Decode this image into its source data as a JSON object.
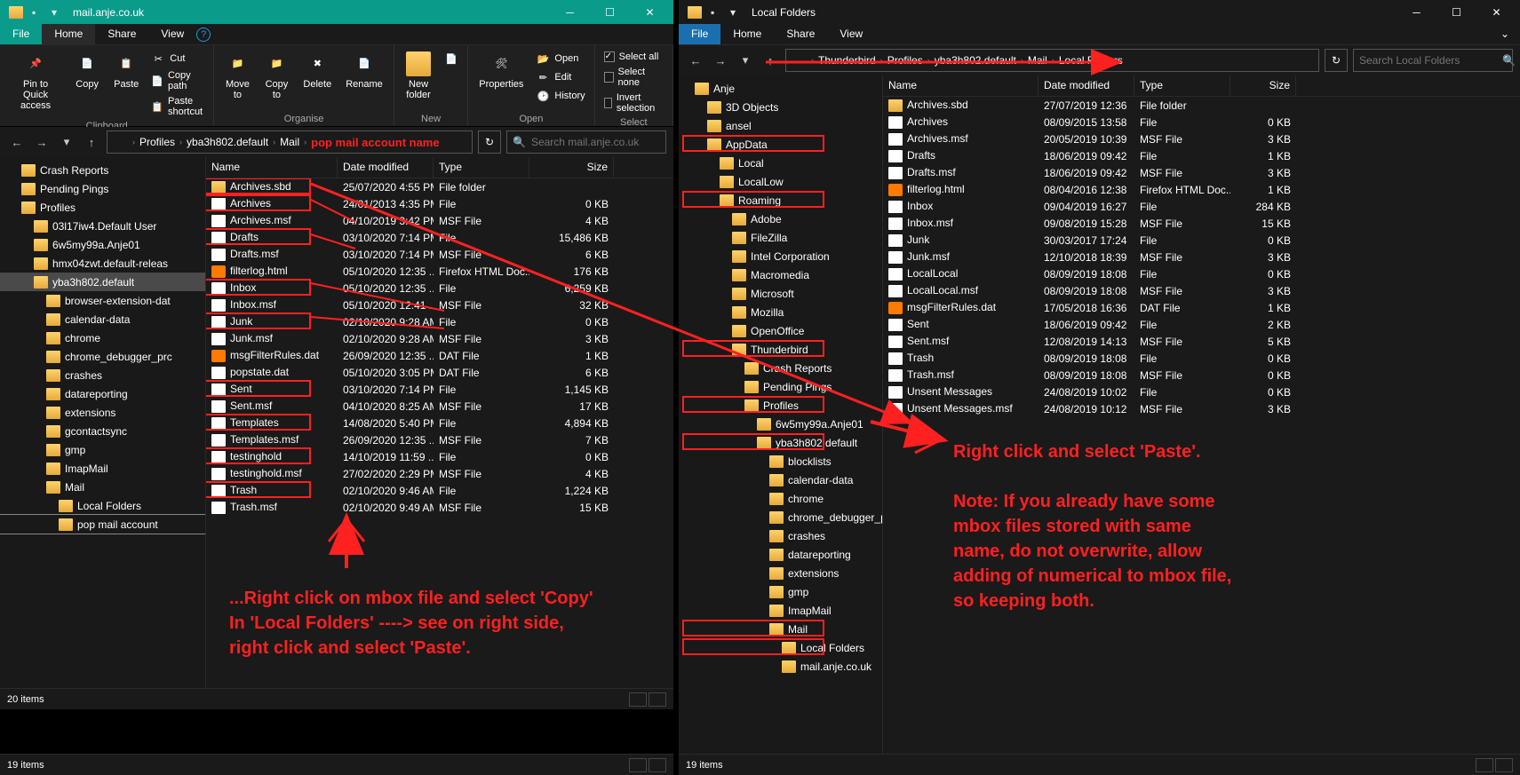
{
  "left": {
    "title": "mail.anje.co.uk",
    "tabs": {
      "file": "File",
      "home": "Home",
      "share": "Share",
      "view": "View"
    },
    "ribbon": {
      "clipboard": {
        "label": "Clipboard",
        "pin": "Pin to Quick access",
        "copy": "Copy",
        "paste": "Paste",
        "cut": "Cut",
        "copypath": "Copy path",
        "shortcut": "Paste shortcut"
      },
      "organise": {
        "label": "Organise",
        "moveto": "Move to",
        "copyto": "Copy to",
        "delete": "Delete",
        "rename": "Rename"
      },
      "new": {
        "label": "New",
        "folder": "New folder"
      },
      "open": {
        "label": "Open",
        "props": "Properties",
        "open": "Open",
        "edit": "Edit",
        "history": "History"
      },
      "select": {
        "label": "Select",
        "all": "Select all",
        "none": "Select none",
        "invert": "Invert selection"
      }
    },
    "breadcrumb": [
      "Profiles",
      "yba3h802.default",
      "Mail"
    ],
    "breadcrumb_ann": "pop mail account name",
    "search_placeholder": "Search mail.anje.co.uk",
    "cols": {
      "name": "Name",
      "date": "Date modified",
      "type": "Type",
      "size": "Size"
    },
    "tree": [
      {
        "label": "Crash Reports",
        "indent": 1
      },
      {
        "label": "Pending Pings",
        "indent": 1
      },
      {
        "label": "Profiles",
        "indent": 1
      },
      {
        "label": "03l17iw4.Default User",
        "indent": 2
      },
      {
        "label": "6w5my99a.Anje01",
        "indent": 2
      },
      {
        "label": "hmx04zwt.default-releas",
        "indent": 2
      },
      {
        "label": "yba3h802.default",
        "indent": 2,
        "sel": true
      },
      {
        "label": "browser-extension-dat",
        "indent": 3
      },
      {
        "label": "calendar-data",
        "indent": 3
      },
      {
        "label": "chrome",
        "indent": 3
      },
      {
        "label": "chrome_debugger_prc",
        "indent": 3
      },
      {
        "label": "crashes",
        "indent": 3
      },
      {
        "label": "datareporting",
        "indent": 3
      },
      {
        "label": "extensions",
        "indent": 3
      },
      {
        "label": "gcontactsync",
        "indent": 3
      },
      {
        "label": "gmp",
        "indent": 3
      },
      {
        "label": "ImapMail",
        "indent": 3
      },
      {
        "label": "Mail",
        "indent": 3
      },
      {
        "label": "Local Folders",
        "indent": 4
      },
      {
        "label": "pop mail account",
        "indent": 4,
        "hl": true
      }
    ],
    "rows": [
      {
        "name": "Archives.sbd",
        "date": "25/07/2020 4:55 PM",
        "type": "File folder",
        "size": "",
        "icon": "folder",
        "box": true
      },
      {
        "name": "Archives",
        "date": "24/01/2013 4:35 PM",
        "type": "File",
        "size": "0 KB",
        "icon": "file",
        "box": true
      },
      {
        "name": "Archives.msf",
        "date": "04/10/2019 3:42 PM",
        "type": "MSF File",
        "size": "4 KB",
        "icon": "file"
      },
      {
        "name": "Drafts",
        "date": "03/10/2020 7:14 PM",
        "type": "File",
        "size": "15,486 KB",
        "icon": "file",
        "box": true
      },
      {
        "name": "Drafts.msf",
        "date": "03/10/2020 7:14 PM",
        "type": "MSF File",
        "size": "6 KB",
        "icon": "file"
      },
      {
        "name": "filterlog.html",
        "date": "05/10/2020 12:35 ...",
        "type": "Firefox HTML Doc...",
        "size": "176 KB",
        "icon": "html"
      },
      {
        "name": "Inbox",
        "date": "05/10/2020 12:35 ...",
        "type": "File",
        "size": "6,259 KB",
        "icon": "file",
        "box": true
      },
      {
        "name": "Inbox.msf",
        "date": "05/10/2020 12:41 ...",
        "type": "MSF File",
        "size": "32 KB",
        "icon": "file"
      },
      {
        "name": "Junk",
        "date": "02/10/2020 9:28 AM",
        "type": "File",
        "size": "0 KB",
        "icon": "file",
        "box": true
      },
      {
        "name": "Junk.msf",
        "date": "02/10/2020 9:28 AM",
        "type": "MSF File",
        "size": "3 KB",
        "icon": "file"
      },
      {
        "name": "msgFilterRules.dat",
        "date": "26/09/2020 12:35 ...",
        "type": "DAT File",
        "size": "1 KB",
        "icon": "html"
      },
      {
        "name": "popstate.dat",
        "date": "05/10/2020 3:05 PM",
        "type": "DAT File",
        "size": "6 KB",
        "icon": "file"
      },
      {
        "name": "Sent",
        "date": "03/10/2020 7:14 PM",
        "type": "File",
        "size": "1,145 KB",
        "icon": "file",
        "box": true
      },
      {
        "name": "Sent.msf",
        "date": "04/10/2020 8:25 AM",
        "type": "MSF File",
        "size": "17 KB",
        "icon": "file"
      },
      {
        "name": "Templates",
        "date": "14/08/2020 5:40 PM",
        "type": "File",
        "size": "4,894 KB",
        "icon": "file",
        "box": true
      },
      {
        "name": "Templates.msf",
        "date": "26/09/2020 12:35 ...",
        "type": "MSF File",
        "size": "7 KB",
        "icon": "file"
      },
      {
        "name": "testinghold",
        "date": "14/10/2019 11:59 ...",
        "type": "File",
        "size": "0 KB",
        "icon": "file",
        "box": true
      },
      {
        "name": "testinghold.msf",
        "date": "27/02/2020 2:29 PM",
        "type": "MSF File",
        "size": "4 KB",
        "icon": "file"
      },
      {
        "name": "Trash",
        "date": "02/10/2020 9:46 AM",
        "type": "File",
        "size": "1,224 KB",
        "icon": "file",
        "box": true
      },
      {
        "name": "Trash.msf",
        "date": "02/10/2020 9:49 AM",
        "type": "MSF File",
        "size": "15 KB",
        "icon": "file"
      }
    ],
    "status": "20 items",
    "status2": "19 items"
  },
  "right": {
    "title": "Local Folders",
    "tabs": {
      "file": "File",
      "home": "Home",
      "share": "Share",
      "view": "View"
    },
    "breadcrumb": [
      "Thunderbird",
      "Profiles",
      "yba3h802.default",
      "Mail",
      "Local Folders"
    ],
    "search_placeholder": "Search Local Folders",
    "cols": {
      "name": "Name",
      "date": "Date modified",
      "type": "Type",
      "size": "Size"
    },
    "tree": [
      {
        "label": "Anje",
        "indent": 1
      },
      {
        "label": "3D Objects",
        "indent": 2,
        "icon": "3d"
      },
      {
        "label": "ansel",
        "indent": 2
      },
      {
        "label": "AppData",
        "indent": 2,
        "box": true
      },
      {
        "label": "Local",
        "indent": 3
      },
      {
        "label": "LocalLow",
        "indent": 3
      },
      {
        "label": "Roaming",
        "indent": 3,
        "box": true
      },
      {
        "label": "Adobe",
        "indent": 4
      },
      {
        "label": "FileZilla",
        "indent": 4
      },
      {
        "label": "Intel Corporation",
        "indent": 4
      },
      {
        "label": "Macromedia",
        "indent": 4
      },
      {
        "label": "Microsoft",
        "indent": 4
      },
      {
        "label": "Mozilla",
        "indent": 4
      },
      {
        "label": "OpenOffice",
        "indent": 4
      },
      {
        "label": "Thunderbird",
        "indent": 4,
        "box": true
      },
      {
        "label": "Crash Reports",
        "indent": 5
      },
      {
        "label": "Pending Pings",
        "indent": 5
      },
      {
        "label": "Profiles",
        "indent": 5,
        "box": true
      },
      {
        "label": "6w5my99a.Anje01",
        "indent": 6
      },
      {
        "label": "yba3h802.default",
        "indent": 6,
        "box": true
      },
      {
        "label": "blocklists",
        "indent": 7
      },
      {
        "label": "calendar-data",
        "indent": 7
      },
      {
        "label": "chrome",
        "indent": 7
      },
      {
        "label": "chrome_debugger_prof",
        "indent": 7
      },
      {
        "label": "crashes",
        "indent": 7
      },
      {
        "label": "datareporting",
        "indent": 7
      },
      {
        "label": "extensions",
        "indent": 7
      },
      {
        "label": "gmp",
        "indent": 7
      },
      {
        "label": "ImapMail",
        "indent": 7
      },
      {
        "label": "Mail",
        "indent": 7,
        "box": true
      },
      {
        "label": "Local Folders",
        "indent": 8,
        "box": true
      },
      {
        "label": "mail.anje.co.uk",
        "indent": 8
      }
    ],
    "rows": [
      {
        "name": "Archives.sbd",
        "date": "27/07/2019 12:36",
        "type": "File folder",
        "size": "",
        "icon": "folder"
      },
      {
        "name": "Archives",
        "date": "08/09/2015 13:58",
        "type": "File",
        "size": "0 KB",
        "icon": "file"
      },
      {
        "name": "Archives.msf",
        "date": "20/05/2019 10:39",
        "type": "MSF File",
        "size": "3 KB",
        "icon": "file"
      },
      {
        "name": "Drafts",
        "date": "18/06/2019 09:42",
        "type": "File",
        "size": "1 KB",
        "icon": "file"
      },
      {
        "name": "Drafts.msf",
        "date": "18/06/2019 09:42",
        "type": "MSF File",
        "size": "3 KB",
        "icon": "file"
      },
      {
        "name": "filterlog.html",
        "date": "08/04/2016 12:38",
        "type": "Firefox HTML Doc...",
        "size": "1 KB",
        "icon": "html"
      },
      {
        "name": "Inbox",
        "date": "09/04/2019 16:27",
        "type": "File",
        "size": "284 KB",
        "icon": "file"
      },
      {
        "name": "Inbox.msf",
        "date": "09/08/2019 15:28",
        "type": "MSF File",
        "size": "15 KB",
        "icon": "file"
      },
      {
        "name": "Junk",
        "date": "30/03/2017 17:24",
        "type": "File",
        "size": "0 KB",
        "icon": "file"
      },
      {
        "name": "Junk.msf",
        "date": "12/10/2018 18:39",
        "type": "MSF File",
        "size": "3 KB",
        "icon": "file"
      },
      {
        "name": "LocalLocal",
        "date": "08/09/2019 18:08",
        "type": "File",
        "size": "0 KB",
        "icon": "file"
      },
      {
        "name": "LocalLocal.msf",
        "date": "08/09/2019 18:08",
        "type": "MSF File",
        "size": "3 KB",
        "icon": "file"
      },
      {
        "name": "msgFilterRules.dat",
        "date": "17/05/2018 16:36",
        "type": "DAT File",
        "size": "1 KB",
        "icon": "html"
      },
      {
        "name": "Sent",
        "date": "18/06/2019 09:42",
        "type": "File",
        "size": "2 KB",
        "icon": "file"
      },
      {
        "name": "Sent.msf",
        "date": "12/08/2019 14:13",
        "type": "MSF File",
        "size": "5 KB",
        "icon": "file"
      },
      {
        "name": "Trash",
        "date": "08/09/2019 18:08",
        "type": "File",
        "size": "0 KB",
        "icon": "file"
      },
      {
        "name": "Trash.msf",
        "date": "08/09/2019 18:08",
        "type": "MSF File",
        "size": "0 KB",
        "icon": "file"
      },
      {
        "name": "Unsent Messages",
        "date": "24/08/2019 10:02",
        "type": "File",
        "size": "0 KB",
        "icon": "file"
      },
      {
        "name": "Unsent Messages.msf",
        "date": "24/08/2019 10:12",
        "type": "MSF File",
        "size": "3 KB",
        "icon": "file"
      }
    ],
    "status": "19 items"
  },
  "annotations": {
    "left_text": "...Right click on mbox file and select 'Copy'\nIn 'Local Folders' ----> see on right side,\nright click and select 'Paste'.",
    "right_text": "Right click and select 'Paste'.\n\nNote: If you already have some\nmbox files stored with same\nname, do not overwrite, allow\nadding of numerical to mbox file,\nso keeping both."
  }
}
